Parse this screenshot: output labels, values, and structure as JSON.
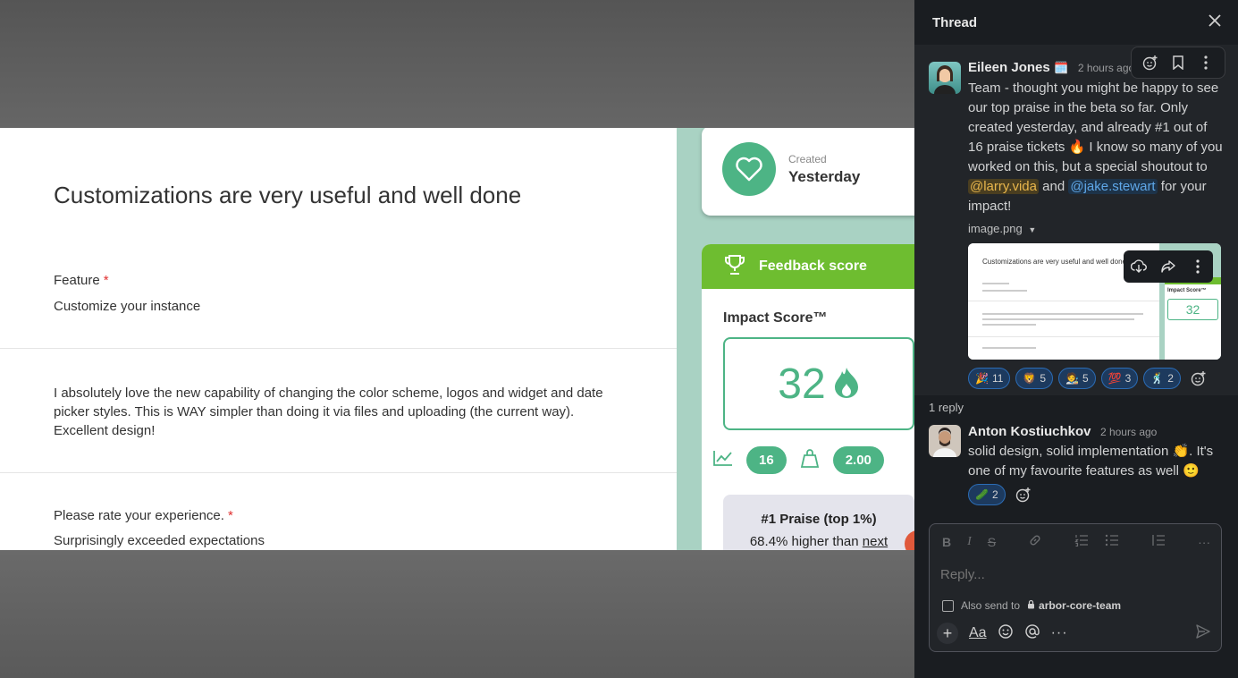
{
  "preview": {
    "form": {
      "title": "Customizations are very useful and well done",
      "feature_label": "Feature",
      "required_mark": "*",
      "feature_value": "Customize your instance",
      "comment": "I absolutely love the new capability of changing the color scheme, logos and widget and date picker styles.  This is WAY simpler than doing it via files and uploading (the current way). Excellent design!",
      "rating_label": "Please rate your experience.",
      "rating_value": "Surprisingly exceeded expectations"
    },
    "side": {
      "created_label": "Created",
      "created_value": "Yesterday",
      "score_header": "Feedback score",
      "impact_title": "Impact Score™",
      "impact_value": "32",
      "stat_count": "16",
      "stat_ratio": "2.00",
      "praise_title": "#1 Praise (top 1%)",
      "praise_sub_prefix": "68.4% higher than ",
      "praise_sub_link": "next"
    }
  },
  "thread": {
    "title": "Thread",
    "parent": {
      "author": "Eileen Jones",
      "status_emoji": "🗓️",
      "time": "2 hours ago",
      "text_1": "Team - thought you might be happy to see our top praise in the beta so far. Only created yesterday, and already #1 out of 16 praise tickets 🔥 I know so many of you worked on this, but a special shoutout to ",
      "mention_1": "@larry.vida",
      "text_and": " and ",
      "mention_2": "@jake.stewart",
      "text_end": " for your impact!",
      "file_name": "image.png",
      "thumb_title": "Customizations are very useful and well done",
      "thumb_score": "32",
      "thumb_score_label": "Impact Score™",
      "reactions": [
        {
          "emoji": "🎉",
          "count": "11"
        },
        {
          "emoji": "🦁",
          "count": "5"
        },
        {
          "emoji": "🧑‍🎨",
          "count": "5"
        },
        {
          "emoji": "💯",
          "count": "3"
        },
        {
          "emoji": "🕺",
          "count": "2"
        }
      ]
    },
    "reply_count": "1 reply",
    "reply": {
      "author": "Anton Kostiuchkov",
      "time": "2 hours ago",
      "text_1": "solid design, solid implementation 👏. It's one of my favourite features as well 🙂",
      "reactions": [
        {
          "emoji": "🥒",
          "count": "2"
        }
      ]
    },
    "composer": {
      "placeholder": "Reply...",
      "also_send_prefix": "Also send to",
      "channel": "arbor-core-team",
      "aa": "Aa"
    }
  },
  "colors": {
    "accent_green": "#4db485",
    "score_header_green": "#6ebd30",
    "panel_bg": "#1a1d21"
  }
}
